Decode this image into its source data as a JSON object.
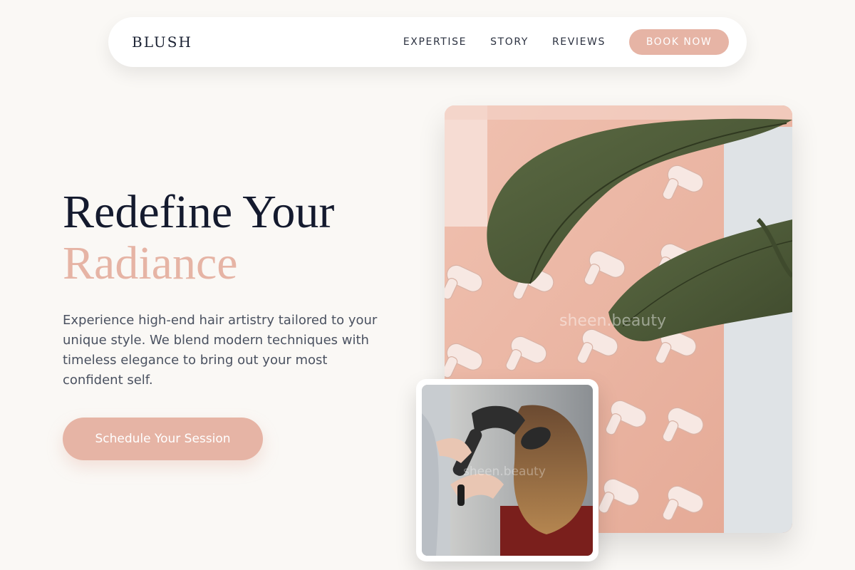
{
  "brand": "BLUSH",
  "nav": {
    "links": [
      "EXPERTISE",
      "STORY",
      "REVIEWS"
    ],
    "cta": "BOOK NOW"
  },
  "hero": {
    "title_line1": "Redefine Your",
    "title_line2": "Radiance",
    "description": "Experience high-end hair artistry tailored to your unique style. We blend modern techniques with timeless elegance to bring out your most confident self.",
    "cta": "Schedule Your Session"
  },
  "images": {
    "main_watermark": "sheen.beauty",
    "inset_watermark": "sheen.beauty"
  },
  "colors": {
    "accent": "#e6b4a5",
    "heading": "#141a2e",
    "background": "#faf8f5"
  }
}
